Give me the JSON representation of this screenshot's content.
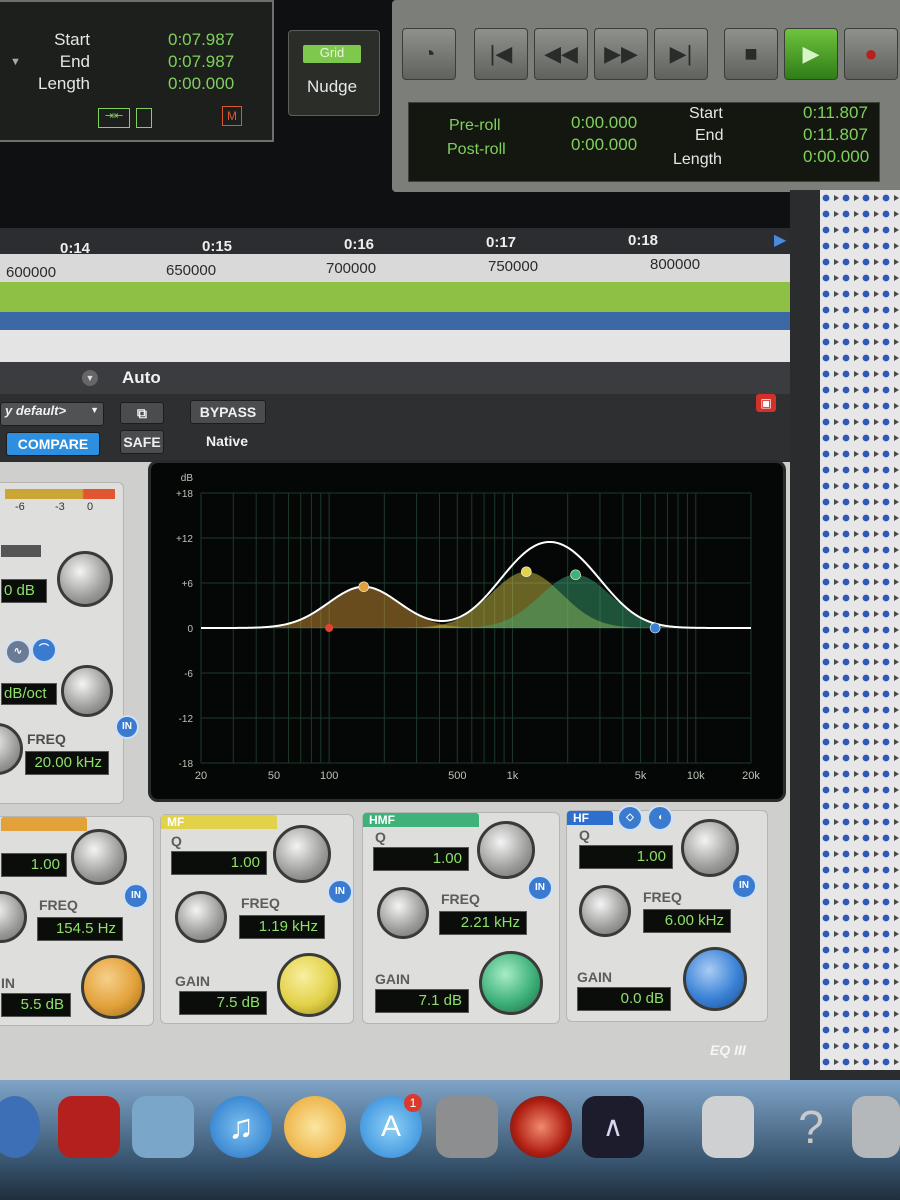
{
  "counter": {
    "start_label": "Start",
    "start_value": "0:07.987",
    "end_label": "End",
    "end_value": "0:07.987",
    "length_label": "Length",
    "length_value": "0:00.000",
    "m_badge": "M"
  },
  "grid_nudge": {
    "grid_label": "Grid",
    "nudge_label": "Nudge"
  },
  "transport": {
    "preroll_label": "Pre-roll",
    "preroll_value": "0:00.000",
    "postroll_label": "Post-roll",
    "postroll_value": "0:00.000",
    "start_label": "Start",
    "start_value": "0:11.807",
    "end_label": "End",
    "end_value": "0:11.807",
    "length_label": "Length",
    "length_value": "0:00.000"
  },
  "timeline": {
    "seconds": [
      "0:14",
      "0:15",
      "0:16",
      "0:17",
      "0:18"
    ],
    "samples": [
      "600000",
      "650000",
      "700000",
      "750000",
      "800000"
    ]
  },
  "plugin": {
    "auto_label": "Auto",
    "preset": "y default>",
    "compare_label": "COMPARE",
    "safe_label": "SAFE",
    "bypass_label": "BYPASS",
    "native_label": "Native",
    "meter_ticks": [
      "-6",
      "-3",
      "0"
    ],
    "input_gain": "0 dB",
    "hpf_slope": "dB/oct",
    "hpf_freq_label": "FREQ",
    "hpf_freq_value": "20.00 kHz",
    "logo": "EQ III"
  },
  "graph": {
    "db_unit": "dB",
    "db_ticks": [
      "+18",
      "+12",
      "+6",
      "0",
      "-6",
      "-12",
      "-18"
    ],
    "freq_ticks": [
      "20",
      "50",
      "100",
      "500",
      "1k",
      "5k",
      "10k",
      "20k"
    ]
  },
  "bands": {
    "lmf": {
      "q_value": "1.00",
      "freq_label": "FREQ",
      "freq_value": "154.5 Hz",
      "gain_label": "IN",
      "gain_value": "5.5 dB",
      "color": "#e3a13a"
    },
    "mf": {
      "title": "MF",
      "q_label": "Q",
      "q_value": "1.00",
      "freq_label": "FREQ",
      "freq_value": "1.19 kHz",
      "gain_label": "GAIN",
      "gain_value": "7.5 dB",
      "color": "#e2d24a"
    },
    "hmf": {
      "title": "HMF",
      "q_label": "Q",
      "q_value": "1.00",
      "freq_label": "FREQ",
      "freq_value": "2.21 kHz",
      "gain_label": "GAIN",
      "gain_value": "7.1 dB",
      "color": "#3fb27a"
    },
    "hf": {
      "title": "HF",
      "q_label": "Q",
      "q_value": "1.00",
      "freq_label": "FREQ",
      "freq_value": "6.00 kHz",
      "gain_label": "GAIN",
      "gain_value": "0.0 dB",
      "color": "#3b82d6"
    }
  },
  "in_label": "IN",
  "dock": {
    "badge": "1"
  }
}
